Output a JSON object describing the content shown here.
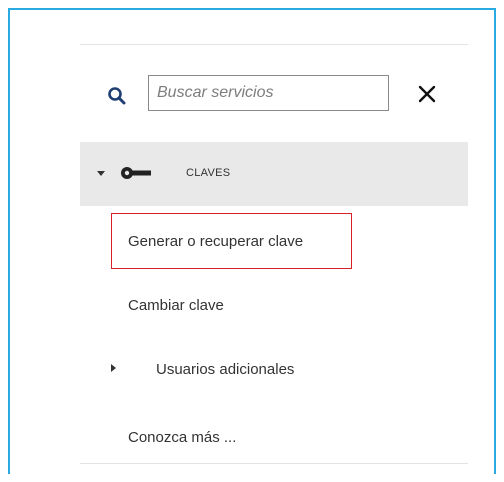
{
  "search": {
    "placeholder": "Buscar servicios",
    "icon": "search-icon",
    "close_icon": "close-icon"
  },
  "section": {
    "label": "CLAVES",
    "icon": "key-icon",
    "expanded": true
  },
  "menu": {
    "items": [
      {
        "label": "Generar o recuperar clave",
        "highlighted": true
      },
      {
        "label": "Cambiar clave"
      },
      {
        "label": "Usuarios adicionales",
        "has_submenu": true
      },
      {
        "label": "Conozca más ..."
      }
    ]
  },
  "colors": {
    "frame_border": "#29abe2",
    "highlight_border": "#d6202a",
    "search_icon": "#1f3f73",
    "section_bg": "#e9e9e9"
  }
}
